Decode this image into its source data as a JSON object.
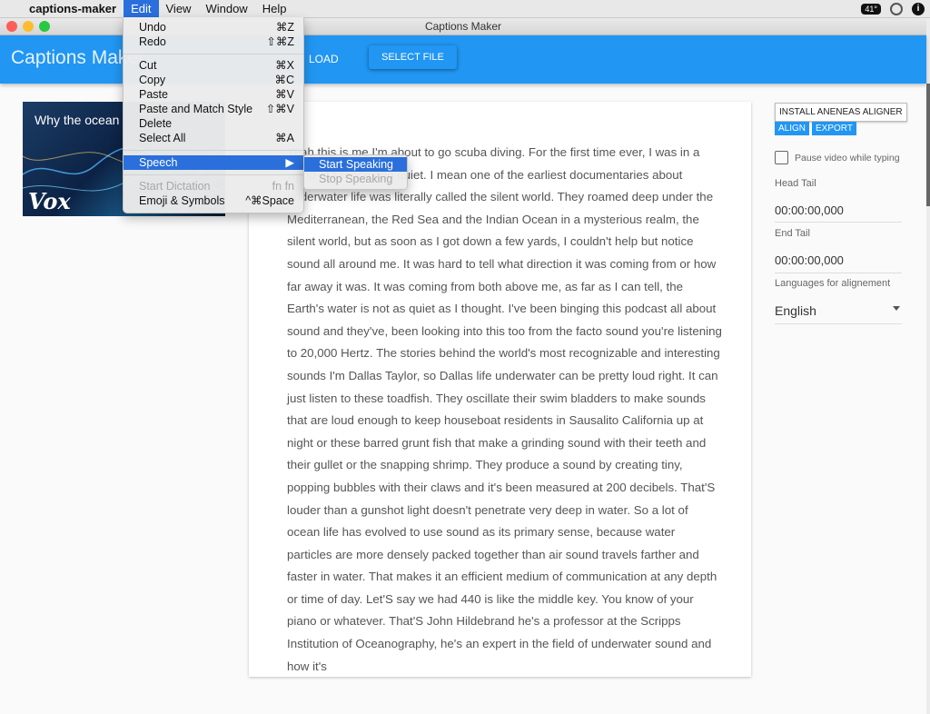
{
  "menubar": {
    "app_name": "captions-maker",
    "menus": [
      "Edit",
      "View",
      "Window",
      "Help"
    ],
    "temperature": "41°"
  },
  "window": {
    "title": "Captions Maker"
  },
  "appbar": {
    "title": "Captions Maker",
    "load_label": "LOAD",
    "select_file_label": "SELECT FILE"
  },
  "video": {
    "title": "Why the ocean",
    "logo": "Vox"
  },
  "transcript": {
    "text": "Yeah this is me I'm about to go scuba diving. For the first time ever, I was in a world of silence and quiet. I mean one of the earliest documentaries about underwater life was literally called the silent world. They roamed deep under the Mediterranean, the Red Sea and the Indian Ocean in a mysterious realm, the silent world, but as soon as I got down a few yards, I couldn't help but notice sound all around me. It was hard to tell what direction it was coming from or how far away it was. It was coming from both above me, as far as I can tell, the Earth's water is not as quiet as I thought. I've been binging this podcast all about sound and they've, been looking into this too from the facto sound you're listening to 20,000 Hertz. The stories behind the world's most recognizable and interesting sounds I'm Dallas Taylor, so Dallas life underwater can be pretty loud right. It can just listen to these toadfish. They oscillate their swim bladders to make sounds that are loud enough to keep houseboat residents in Sausalito California up at night or these barred grunt fish that make a grinding sound with their teeth and their gullet or the snapping shrimp. They produce a sound by creating tiny, popping bubbles with their claws and it's been measured at 200 decibels. That'S louder than a gunshot light doesn't penetrate very deep in water. So a lot of ocean life has evolved to use sound as its primary sense, because water particles are more densely packed together than air sound travels farther and faster in water. That makes it an efficient medium of communication at any depth or time of day. Let'S say we had 440 is like the middle key. You know of your piano or whatever. That'S John Hildebrand he's a professor at the Scripps Institution of Oceanography, he's an expert in the field of underwater sound and how it's"
  },
  "panel": {
    "install_label": "INSTALL ANENEAS ALIGNER",
    "align_label": "ALIGN",
    "export_label": "EXPORT",
    "pause_label": "Pause video while typing",
    "head_tail_label": "Head Tail",
    "head_tail_value": "00:00:00,000",
    "end_tail_label": "End Tail",
    "end_tail_value": "00:00:00,000",
    "languages_label": "Languages for alignement",
    "language_value": "English"
  },
  "edit_menu": {
    "undo": "Undo",
    "undo_key": "⌘Z",
    "redo": "Redo",
    "redo_key": "⇧⌘Z",
    "cut": "Cut",
    "cut_key": "⌘X",
    "copy": "Copy",
    "copy_key": "⌘C",
    "paste": "Paste",
    "paste_key": "⌘V",
    "paste_match": "Paste and Match Style",
    "paste_match_key": "⇧⌘V",
    "delete": "Delete",
    "select_all": "Select All",
    "select_all_key": "⌘A",
    "speech": "Speech",
    "start_dictation": "Start Dictation",
    "start_dictation_key": "fn fn",
    "emoji": "Emoji & Symbols",
    "emoji_key": "^⌘Space"
  },
  "speech_submenu": {
    "start": "Start Speaking",
    "stop": "Stop Speaking"
  }
}
